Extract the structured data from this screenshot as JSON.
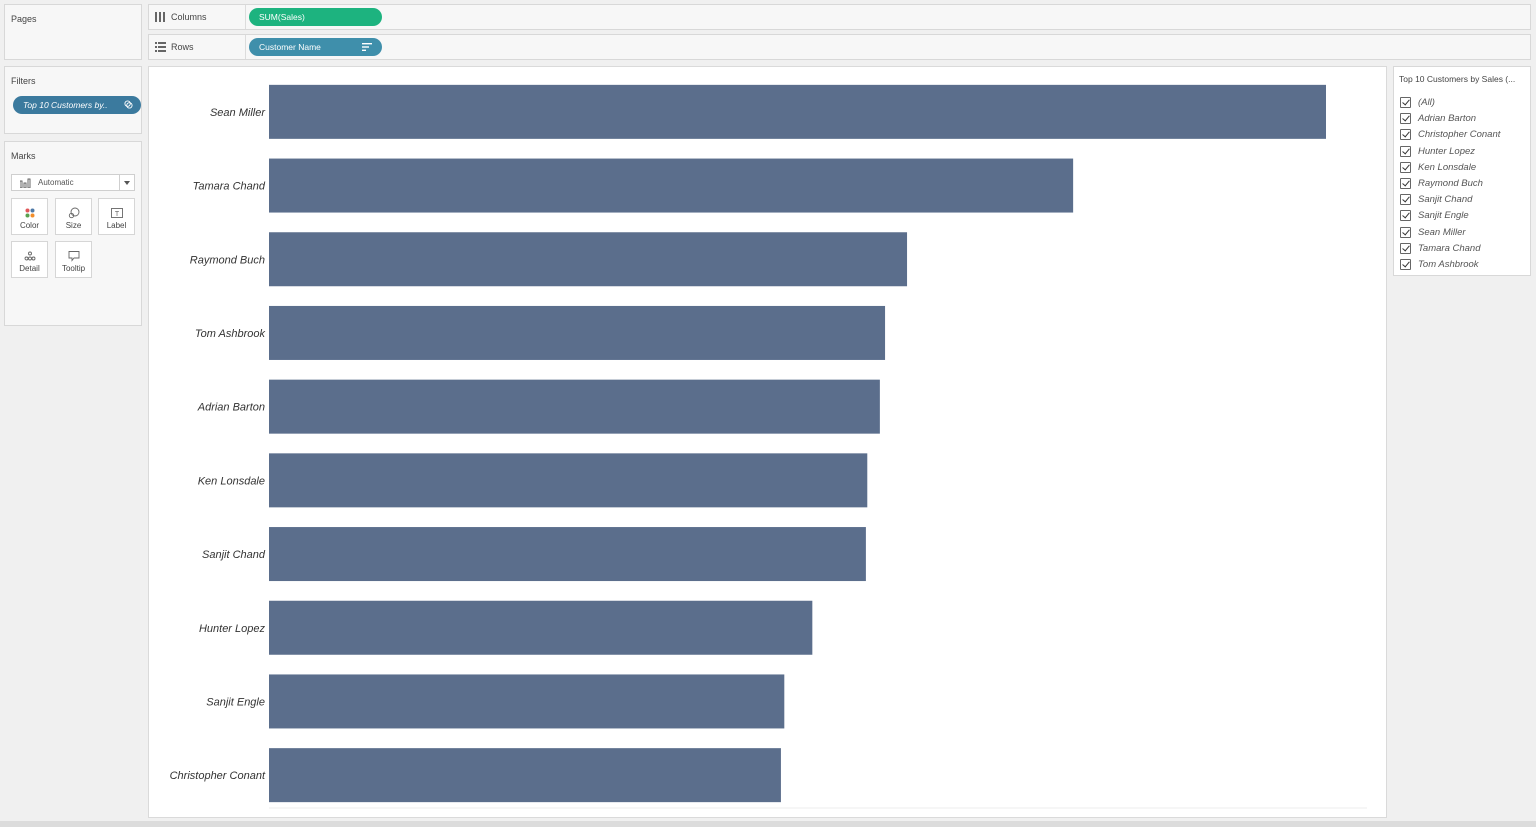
{
  "cards": {
    "pages": {
      "title": "Pages"
    },
    "filters": {
      "title": "Filters",
      "pill": "Top 10 Customers by.."
    },
    "marks": {
      "title": "Marks",
      "type": "Automatic",
      "buttons": [
        {
          "label": "Color",
          "icon": "color-icon"
        },
        {
          "label": "Size",
          "icon": "size-icon"
        },
        {
          "label": "Label",
          "icon": "label-icon"
        },
        {
          "label": "Detail",
          "icon": "detail-icon"
        },
        {
          "label": "Tooltip",
          "icon": "tooltip-icon"
        }
      ]
    }
  },
  "shelves": {
    "columns": {
      "label": "Columns",
      "pill": "SUM(Sales)",
      "pill_color": "#1db37f"
    },
    "rows": {
      "label": "Rows",
      "pill": "Customer Name",
      "pill_color": "#3f8fab"
    }
  },
  "legend": {
    "title": "Top 10 Customers by Sales (...",
    "items": [
      "(All)",
      "Adrian Barton",
      "Christopher Conant",
      "Hunter Lopez",
      "Ken Lonsdale",
      "Raymond Buch",
      "Sanjit Chand",
      "Sanjit Engle",
      "Sean Miller",
      "Tamara Chand",
      "Tom Ashbrook"
    ],
    "all_checked": true
  },
  "colors": {
    "bar": "#5b6e8c"
  },
  "chart_data": {
    "type": "bar",
    "orientation": "horizontal",
    "categories": [
      "Sean Miller",
      "Tamara Chand",
      "Raymond Buch",
      "Tom Ashbrook",
      "Adrian Barton",
      "Ken Lonsdale",
      "Sanjit Chand",
      "Hunter Lopez",
      "Sanjit Engle",
      "Christopher Conant"
    ],
    "values": [
      25043,
      19052,
      15117,
      14596,
      14473,
      14175,
      14142,
      12873,
      12209,
      12129
    ],
    "xlim": [
      0,
      26000
    ],
    "title": "",
    "xlabel": "",
    "ylabel": "",
    "grid": false
  }
}
